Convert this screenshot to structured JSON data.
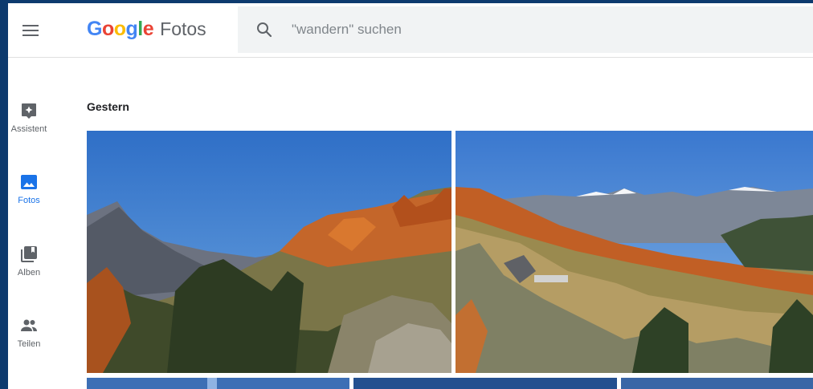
{
  "app": {
    "logo": {
      "letters": [
        {
          "char": "G",
          "color": "#4285f4"
        },
        {
          "char": "o",
          "color": "#ea4335"
        },
        {
          "char": "o",
          "color": "#fbbc05"
        },
        {
          "char": "g",
          "color": "#4285f4"
        },
        {
          "char": "l",
          "color": "#34a853"
        },
        {
          "char": "e",
          "color": "#ea4335"
        }
      ],
      "product": "Fotos"
    },
    "search": {
      "placeholder": "\"wandern\" suchen"
    }
  },
  "sidebar": {
    "items": [
      {
        "label": "Assistent",
        "icon": "assistant-icon",
        "active": false
      },
      {
        "label": "Fotos",
        "icon": "photo-icon",
        "active": true
      },
      {
        "label": "Alben",
        "icon": "albums-icon",
        "active": false
      },
      {
        "label": "Teilen",
        "icon": "people-icon",
        "active": false
      }
    ]
  },
  "main": {
    "section_title": "Gestern",
    "photos": [
      {
        "subject": "autumn larch forest and mountain peak under blue sky"
      },
      {
        "subject": "alpine panorama with snowy peaks and hut on slope"
      },
      {
        "subject": "blue sky"
      },
      {
        "subject": "blue sky"
      },
      {
        "subject": "blue sky"
      }
    ]
  },
  "colors": {
    "accent": "#1a73e8",
    "icon": "#5f6368",
    "frame": "#0d3a6e"
  }
}
